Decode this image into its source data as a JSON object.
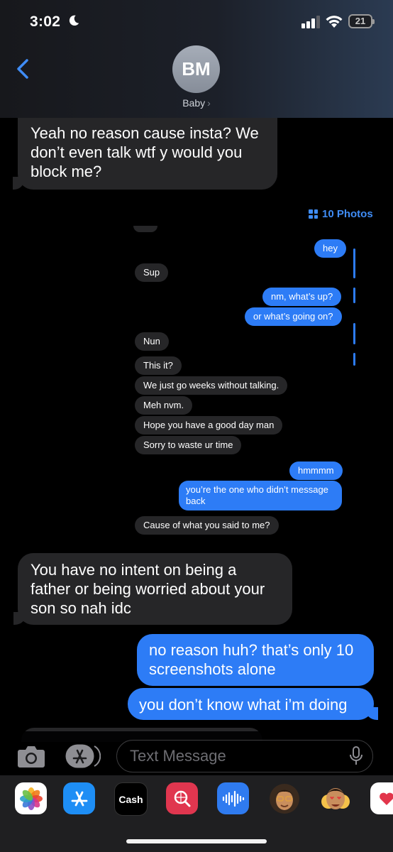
{
  "status": {
    "time": "3:02",
    "battery": "21"
  },
  "header": {
    "initials": "BM",
    "contact_name": "Baby",
    "chevron": "›"
  },
  "messages": [
    {
      "side": "received",
      "text": "Yeah no reason cause insta? We don’t even talk wtf y would you block me?"
    },
    {
      "side": "received",
      "text": "You have no intent on being a father or being worried about your son so nah idc"
    },
    {
      "side": "sent",
      "text": "no reason huh? that’s only 10 screenshots alone"
    },
    {
      "side": "sent",
      "text": "you don’t know what i’m doing"
    }
  ],
  "photos_link": "10 Photos",
  "screenshot": {
    "messages": [
      {
        "side": "sent",
        "text": "hey"
      },
      {
        "side": "received",
        "text": "Sup"
      },
      {
        "side": "sent",
        "text": "nm, what’s up?"
      },
      {
        "side": "sent",
        "text": "or what’s going on?"
      },
      {
        "side": "received",
        "text": "Nun"
      },
      {
        "side": "received",
        "text": "This it?"
      },
      {
        "side": "received",
        "text": "We just go weeks without talking."
      },
      {
        "side": "received",
        "text": "Meh nvm."
      },
      {
        "side": "received",
        "text": "Hope you have a good day man"
      },
      {
        "side": "received",
        "text": "Sorry to waste ur time"
      },
      {
        "side": "sent",
        "text": "hmmmm"
      },
      {
        "side": "sent",
        "text": "you’re the one who didn’t message back"
      },
      {
        "side": "received",
        "text": "Cause of what you said to me?"
      }
    ]
  },
  "composer": {
    "placeholder": "Text Message"
  },
  "app_drawer": {
    "apps": [
      {
        "icon": "photos-icon"
      },
      {
        "icon": "app-store-icon"
      },
      {
        "icon": "apple-cash-icon",
        "label": "Cash"
      },
      {
        "icon": "image-search-icon"
      },
      {
        "icon": "audio-message-icon"
      },
      {
        "icon": "memoji-icon"
      },
      {
        "icon": "memoji-stickers-icon"
      },
      {
        "icon": "digital-touch-icon"
      }
    ]
  },
  "colors": {
    "sent": "#2d7cf6",
    "received": "#262628",
    "link": "#3f8cf5"
  }
}
